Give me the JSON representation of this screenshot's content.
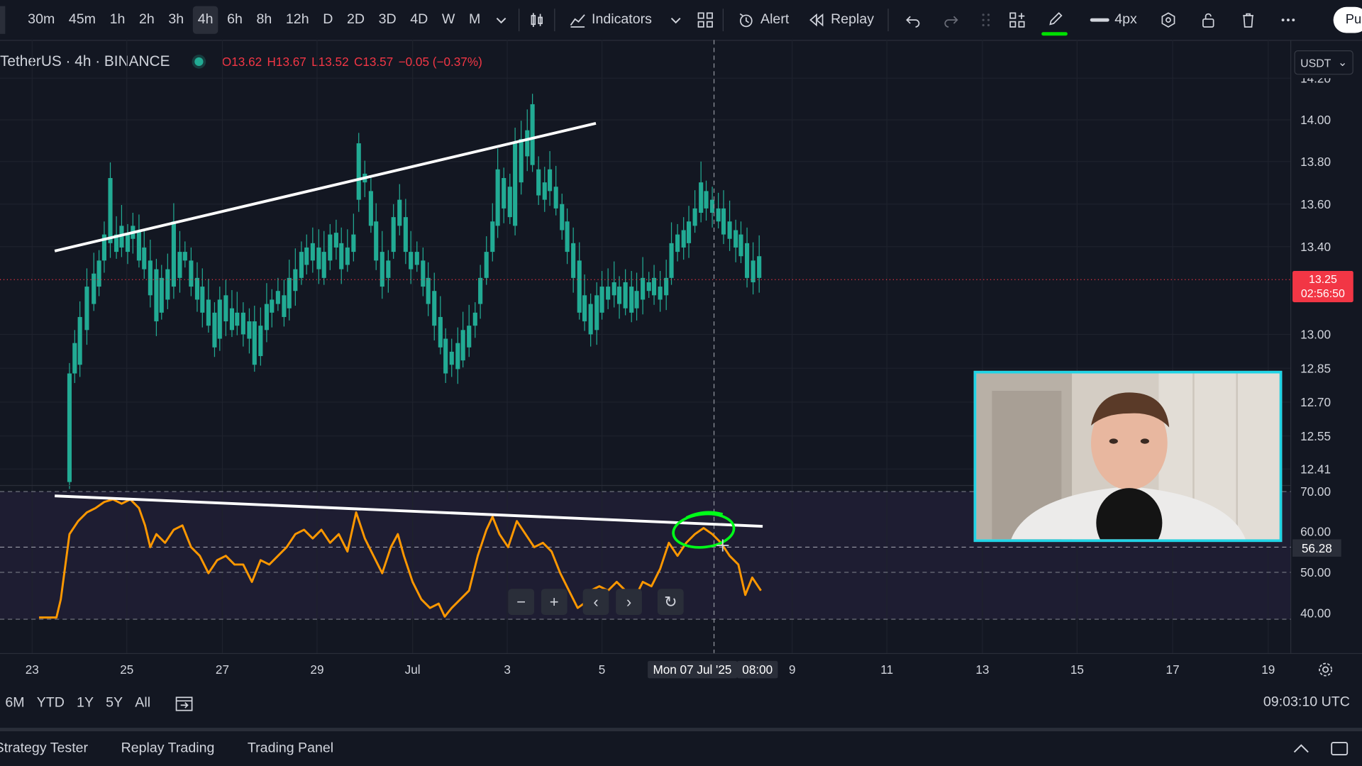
{
  "toolbar": {
    "timeframes": [
      "30m",
      "45m",
      "1h",
      "2h",
      "3h",
      "4h",
      "6h",
      "8h",
      "12h",
      "D",
      "2D",
      "3D",
      "4D",
      "W",
      "M"
    ],
    "active_timeframe": "4h",
    "indicators_label": "Indicators",
    "alert_label": "Alert",
    "replay_label": "Replay",
    "stroke_width": "4px",
    "publish_label": "Pu"
  },
  "legend": {
    "symbol": "TetherUS · 4h · BINANCE",
    "open": "O13.62",
    "high": "H13.67",
    "low": "L13.52",
    "close": "C13.57",
    "change": "−0.05 (−0.37%)"
  },
  "currency_select": "USDT",
  "price_axis": {
    "labels": [
      "14.20",
      "14.00",
      "13.80",
      "13.60",
      "13.40",
      "13.00",
      "12.85",
      "12.70",
      "12.55",
      "12.41"
    ],
    "current_price": "13.25",
    "countdown": "02:56:50"
  },
  "rsi_axis": {
    "labels": [
      "70.00",
      "60.00",
      "50.00",
      "40.00"
    ],
    "current_value": "56.28"
  },
  "time_axis": {
    "labels": [
      "23",
      "25",
      "27",
      "29",
      "Jul",
      "3",
      "5",
      "9",
      "11",
      "13",
      "15",
      "17",
      "19"
    ],
    "crosshair_label": "Mon 07 Jul '25",
    "crosshair_time": "08:00"
  },
  "range_buttons": [
    "6M",
    "YTD",
    "1Y",
    "5Y",
    "All"
  ],
  "clock": "09:03:10 UTC",
  "bottom_tabs": [
    "Strategy Tester",
    "Replay Trading",
    "Trading Panel"
  ],
  "colors": {
    "up": "#22ab94",
    "down": "#f23645",
    "rsi_line": "#ff9800",
    "annotation": "#00ff19",
    "webcam_border": "#20d4e6"
  },
  "icons": {
    "undo": "undo-icon",
    "redo": "redo-icon",
    "trash": "trash-icon",
    "settings": "gear-icon"
  }
}
